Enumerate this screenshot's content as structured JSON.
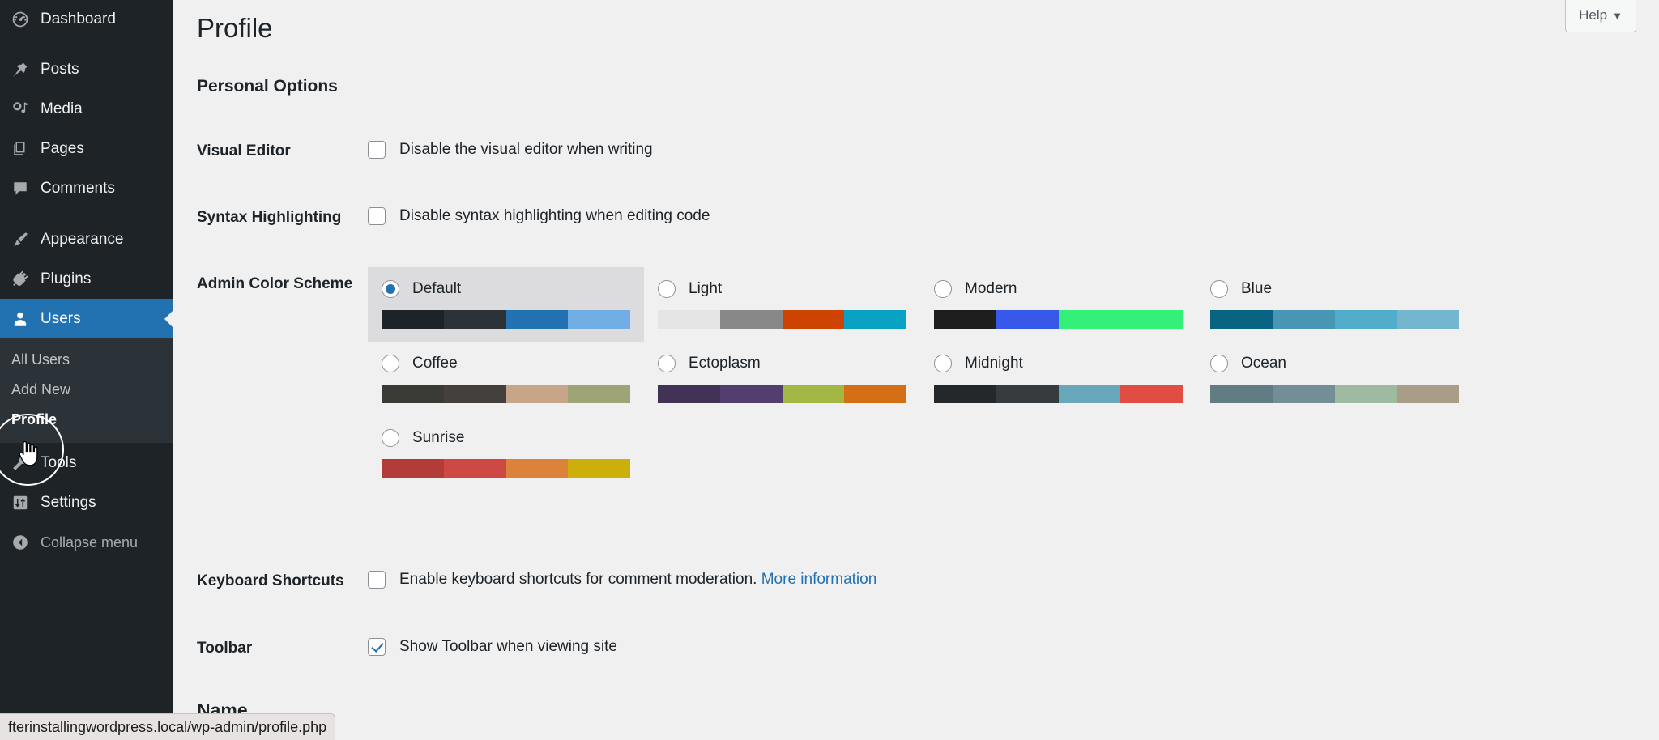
{
  "sidebar": {
    "items": [
      {
        "label": "Dashboard",
        "icon": "dashboard-icon"
      },
      {
        "label": "Posts",
        "icon": "pin-icon"
      },
      {
        "label": "Media",
        "icon": "media-icon"
      },
      {
        "label": "Pages",
        "icon": "page-icon"
      },
      {
        "label": "Comments",
        "icon": "comment-icon"
      },
      {
        "label": "Appearance",
        "icon": "brush-icon"
      },
      {
        "label": "Plugins",
        "icon": "plugin-icon"
      },
      {
        "label": "Users",
        "icon": "user-icon"
      },
      {
        "label": "Tools",
        "icon": "tools-icon"
      },
      {
        "label": "Settings",
        "icon": "settings-icon"
      },
      {
        "label": "Collapse menu",
        "icon": "collapse-arrow-icon"
      }
    ],
    "active_item": "Users",
    "submenu": {
      "items": [
        {
          "label": "All Users"
        },
        {
          "label": "Add New"
        },
        {
          "label": "Profile"
        }
      ],
      "active_item": "Profile"
    },
    "accent_color": "#2271b1",
    "background_color": "#1d2327",
    "submenu_background_color": "#2c3338"
  },
  "header": {
    "help_label": "Help",
    "help_caret": "▼"
  },
  "main": {
    "page_title": "Profile",
    "section_heading": "Personal Options",
    "rows": {
      "visual_editor": {
        "label": "Visual Editor",
        "checkbox_label": "Disable the visual editor when writing",
        "checked": false
      },
      "syntax_highlighting": {
        "label": "Syntax Highlighting",
        "checkbox_label": "Disable syntax highlighting when editing code",
        "checked": false
      },
      "admin_color_scheme": {
        "label": "Admin Color Scheme"
      },
      "keyboard_shortcuts": {
        "label": "Keyboard Shortcuts",
        "checkbox_label": "Enable keyboard shortcuts for comment moderation.",
        "link_label": "More information",
        "checked": false
      },
      "toolbar": {
        "label": "Toolbar",
        "checkbox_label": "Show Toolbar when viewing site",
        "checked": true
      },
      "name": {
        "label": "Name"
      }
    },
    "color_schemes": [
      {
        "name": "Default",
        "selected": true,
        "colors": [
          "#1d2327",
          "#2c3338",
          "#2271b1",
          "#72aee6"
        ]
      },
      {
        "name": "Light",
        "selected": false,
        "colors": [
          "#e5e5e5",
          "#888888",
          "#cc4302",
          "#0aa2c4"
        ]
      },
      {
        "name": "Modern",
        "selected": false,
        "colors": [
          "#1e1e1e",
          "#3858e9",
          "#33f078",
          "#33f078"
        ]
      },
      {
        "name": "Blue",
        "selected": false,
        "colors": [
          "#096484",
          "#4796b3",
          "#52accc",
          "#74b6ce"
        ]
      },
      {
        "name": "Coffee",
        "selected": false,
        "colors": [
          "#3a3a36",
          "#46403c",
          "#c7a589",
          "#9ea476"
        ]
      },
      {
        "name": "Ectoplasm",
        "selected": false,
        "colors": [
          "#413256",
          "#523f6d",
          "#a3b745",
          "#d46f15"
        ]
      },
      {
        "name": "Midnight",
        "selected": false,
        "colors": [
          "#25282b",
          "#363b3f",
          "#69a8bb",
          "#e14d43"
        ]
      },
      {
        "name": "Ocean",
        "selected": false,
        "colors": [
          "#627c83",
          "#738e96",
          "#9ebaa0",
          "#aa9d88"
        ]
      },
      {
        "name": "Sunrise",
        "selected": false,
        "colors": [
          "#b43c38",
          "#cf4944",
          "#dd823b",
          "#ccaf0b"
        ]
      }
    ]
  },
  "status_bar": {
    "url": "fterinstallingwordpress.local/wp-admin/profile.php"
  }
}
